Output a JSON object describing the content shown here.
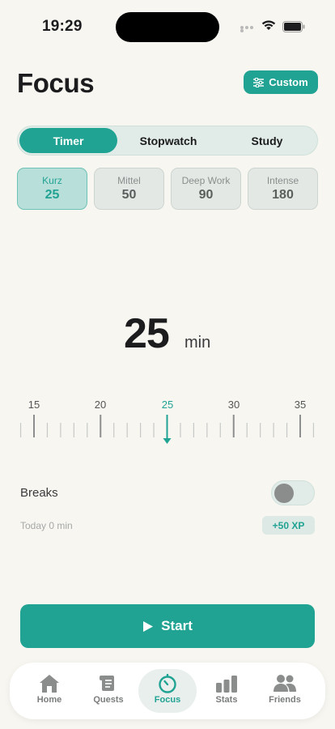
{
  "status_bar": {
    "time": "19:29"
  },
  "header": {
    "title": "Focus",
    "custom_label": "Custom"
  },
  "segments": [
    {
      "label": "Timer",
      "active": true
    },
    {
      "label": "Stopwatch",
      "active": false
    },
    {
      "label": "Study",
      "active": false
    }
  ],
  "presets": [
    {
      "name": "Kurz",
      "value": "25",
      "active": true
    },
    {
      "name": "Mittel",
      "value": "50",
      "active": false
    },
    {
      "name": "Deep Work",
      "value": "90",
      "active": false
    },
    {
      "name": "Intense",
      "value": "180",
      "active": false
    }
  ],
  "timer": {
    "value": "25",
    "unit": "min"
  },
  "ruler": {
    "labels": [
      "15",
      "20",
      "25",
      "30",
      "35"
    ],
    "selected": 25,
    "min": 15,
    "max": 35
  },
  "breaks": {
    "label": "Breaks",
    "enabled": false
  },
  "today": {
    "text": "Today 0 min"
  },
  "xp": {
    "text": "+50 XP"
  },
  "start": {
    "label": "Start"
  },
  "tabs": [
    {
      "label": "Home",
      "icon": "home-icon",
      "active": false
    },
    {
      "label": "Quests",
      "icon": "scroll-icon",
      "active": false
    },
    {
      "label": "Focus",
      "icon": "timer-icon",
      "active": true
    },
    {
      "label": "Stats",
      "icon": "bar-chart-icon",
      "active": false
    },
    {
      "label": "Friends",
      "icon": "people-icon",
      "active": false
    }
  ],
  "colors": {
    "accent": "#21a393",
    "background": "#f7f6f1"
  }
}
